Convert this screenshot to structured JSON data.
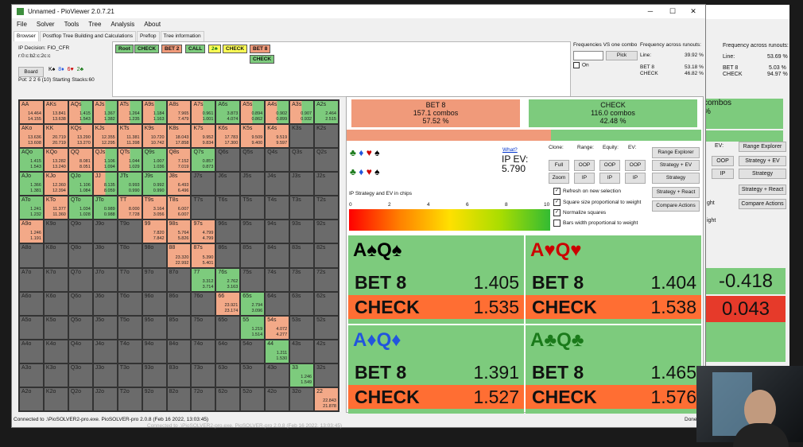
{
  "window": {
    "title": "Unnamed - PioViewer 2.0.7.21",
    "minimize": "─",
    "maximize": "☐",
    "close": "✕"
  },
  "menu": [
    "File",
    "Solver",
    "Tools",
    "Tree",
    "Analysis",
    "About"
  ],
  "tabs": [
    "Browser",
    "Postflop Tree Building and Calculations",
    "Preflop",
    "Tree information"
  ],
  "info": {
    "decision": "IP Decision:  FIO_CFR",
    "board_line": "r:0:c:b2:c:2c:c",
    "board_btn": "Board",
    "board_cards": [
      "K♠",
      "8♦",
      "6♥",
      "2♣"
    ],
    "pot": "Pot: 2 2 6 (10)  Starting Stacks:60"
  },
  "tree": {
    "nodes": [
      "Root",
      "CHECK",
      "BET 2",
      "CALL",
      "2♣",
      "CHECK",
      "BET 8"
    ],
    "sub": "CHECK"
  },
  "freq": {
    "vs_one": "Frequencies VS one combo",
    "pick": "Pick",
    "on": "On",
    "across": "Frequency across runouts:",
    "line_label": "Line:",
    "line_val": "39.92 %",
    "bet_label": "BET 8",
    "bet_val": "53.18 %",
    "check_label": "CHECK",
    "check_val": "46.82 %"
  },
  "bg": {
    "freq_title": "Frequency across runouts:",
    "line_label": "Line:",
    "line_val": "53.69 %",
    "bet_label": "BET 8",
    "bet_val": "5.03 %",
    "check_label": "CHECK",
    "check_val": "94.97 %",
    "ev": "EV:",
    "oop": "OOP",
    "ip": "IP",
    "range": "Range Explorer",
    "sev": "Strategy + EV",
    "str": "Strategy",
    "sr": "Strategy + React",
    "ca": "Compare Actions",
    "v1": "-0.418",
    "v2": "0.043",
    "combos": "combos",
    "pct": "%",
    "ght": "ght",
    "ight": "ight"
  },
  "actions": {
    "bet": {
      "name": "BET 8",
      "combos": "157.1 combos",
      "pct": "57.52 %"
    },
    "check": {
      "name": "CHECK",
      "combos": "116.0 combos",
      "pct": "42.48 %"
    }
  },
  "combos_rows": [
    [
      "♣",
      "♦",
      "♥",
      "♠"
    ],
    [
      "♣",
      "♦",
      "♥",
      "♠"
    ]
  ],
  "ev": {
    "what": "What?",
    "label": "IP EV:",
    "value": "5.790"
  },
  "controls": {
    "clone": "Clone:",
    "range": "Range:",
    "equity": "Equity:",
    "evl": "EV:",
    "full": "Full",
    "zoom": "Zoom",
    "oop": "OOP",
    "ip": "IP",
    "range_explorer": "Range Explorer",
    "strategy_ev": "Strategy + EV",
    "strategy": "Strategy",
    "strategy_react": "Strategy + React",
    "compare": "Compare Actions"
  },
  "scale": {
    "label": "IP Strategy and EV in chips",
    "ticks": [
      "0",
      "2",
      "4",
      "6",
      "8",
      "10"
    ]
  },
  "checks": [
    {
      "on": true,
      "label": "Refresh on new selection"
    },
    {
      "on": true,
      "label": "Square size proportional to weight"
    },
    {
      "on": true,
      "label": "Normalize squares"
    },
    {
      "on": false,
      "label": "Bars width proportional to weight"
    }
  ],
  "bigcells": [
    {
      "r1": "A",
      "s1": "♠",
      "r2": "Q",
      "s2": "♠",
      "color": "#000000",
      "bet": "1.405",
      "check": "1.535"
    },
    {
      "r1": "A",
      "s1": "♥",
      "r2": "Q",
      "s2": "♥",
      "color": "#cc0000",
      "bet": "1.404",
      "check": "1.538"
    },
    {
      "r1": "A",
      "s1": "♦",
      "r2": "Q",
      "s2": "♦",
      "color": "#2255dd",
      "bet": "1.391",
      "check": "1.527"
    },
    {
      "r1": "A",
      "s1": "♣",
      "r2": "Q",
      "s2": "♣",
      "color": "#1a7a1a",
      "bet": "1.465",
      "check": "1.576"
    }
  ],
  "bet_word": "BET 8",
  "check_word": "CHECK",
  "status": "Connected to .\\PioSOLVER2-pro.exe.  PioSOLVER-pro 2.0.8 (Feb 16 2022, 13:03:45)",
  "status_dim": "Connected to .\\PioSOLVER2-pro.exe.  PioSOLVER-pro 2.0.8 (Feb 16 2022, 13:03:45)",
  "done": "Done",
  "matrix_rows": [
    [
      {
        "l": "AA",
        "a": "14.464",
        "b": "14.155",
        "c": "h"
      },
      {
        "l": "AKs",
        "a": "13.841",
        "b": "13.638",
        "c": "h"
      },
      {
        "l": "AQs",
        "a": "1.415",
        "b": "1.543",
        "c": "m"
      },
      {
        "l": "AJs",
        "a": "1.367",
        "b": "1.382",
        "c": "m"
      },
      {
        "l": "ATs",
        "a": "1.264",
        "b": "1.235",
        "c": "m"
      },
      {
        "l": "A9s",
        "a": "1.184",
        "b": "1.163",
        "c": "m"
      },
      {
        "l": "A8s",
        "a": "7.965",
        "b": "7.479",
        "c": "h"
      },
      {
        "l": "A7s",
        "a": "0.961",
        "b": "1.001",
        "c": "m"
      },
      {
        "l": "A6s",
        "a": "3.873",
        "b": "4.074",
        "c": "c"
      },
      {
        "l": "A5s",
        "a": "0.894",
        "b": "0.862",
        "c": "m"
      },
      {
        "l": "A4s",
        "a": "0.902",
        "b": "0.899",
        "c": "m"
      },
      {
        "l": "A3s",
        "a": "0.907",
        "b": "0.932",
        "c": "m"
      },
      {
        "l": "A2s",
        "a": "2.464",
        "b": "2.515",
        "c": "c"
      }
    ],
    [
      {
        "l": "AKo",
        "a": "13.636",
        "b": "13.608",
        "c": "h"
      },
      {
        "l": "KK",
        "a": "20.719",
        "b": "20.719",
        "c": "h"
      },
      {
        "l": "KQs",
        "a": "13.290",
        "b": "13.270",
        "c": "h"
      },
      {
        "l": "KJs",
        "a": "12.355",
        "b": "12.295",
        "c": "h"
      },
      {
        "l": "KTs",
        "a": "11.381",
        "b": "11.398",
        "c": "h"
      },
      {
        "l": "K9s",
        "a": "10.720",
        "b": "10.742",
        "c": "h"
      },
      {
        "l": "K8s",
        "a": "18.043",
        "b": "17.858",
        "c": "h"
      },
      {
        "l": "K7s",
        "a": "9.952",
        "b": "9.834",
        "c": "h"
      },
      {
        "l": "K6s",
        "a": "17.783",
        "b": "17.300",
        "c": "h"
      },
      {
        "l": "K5s",
        "a": "9.509",
        "b": "9.400",
        "c": "h"
      },
      {
        "l": "K4s",
        "a": "9.519",
        "b": "9.597",
        "c": "h"
      },
      {
        "l": "K3s",
        "a": "",
        "b": "",
        "c": "g"
      },
      {
        "l": "K2s",
        "a": "",
        "b": "",
        "c": "g"
      }
    ],
    [
      {
        "l": "AQo",
        "a": "1.415",
        "b": "1.543",
        "c": "c"
      },
      {
        "l": "KQo",
        "a": "13.282",
        "b": "13.240",
        "c": "h"
      },
      {
        "l": "QQ",
        "a": "8.081",
        "b": "8.051",
        "c": "h"
      },
      {
        "l": "QJs",
        "a": "1.106",
        "b": "1.094",
        "c": "m"
      },
      {
        "l": "QTs",
        "a": "1.044",
        "b": "1.029",
        "c": "m"
      },
      {
        "l": "Q9s",
        "a": "1.007",
        "b": "1.036",
        "c": "c"
      },
      {
        "l": "Q8s",
        "a": "7.152",
        "b": "7.019",
        "c": "h"
      },
      {
        "l": "Q7s",
        "a": "0.857",
        "b": "0.873",
        "c": "c"
      },
      {
        "l": "Q6s",
        "a": "",
        "b": "",
        "c": "g"
      },
      {
        "l": "Q5s",
        "a": "",
        "b": "",
        "c": "g"
      },
      {
        "l": "Q4s",
        "a": "",
        "b": "",
        "c": "g"
      },
      {
        "l": "Q3s",
        "a": "",
        "b": "",
        "c": "g"
      },
      {
        "l": "Q2s",
        "a": "",
        "b": "",
        "c": "g"
      }
    ],
    [
      {
        "l": "AJo",
        "a": "1.366",
        "b": "1.381",
        "c": "c"
      },
      {
        "l": "KJo",
        "a": "12.360",
        "b": "12.394",
        "c": "h"
      },
      {
        "l": "QJo",
        "a": "1.106",
        "b": "1.084",
        "c": "c"
      },
      {
        "l": "JJ",
        "a": "8.135",
        "b": "8.059",
        "c": "m"
      },
      {
        "l": "JTs",
        "a": "0.993",
        "b": "0.990",
        "c": "c"
      },
      {
        "l": "J9s",
        "a": "0.992",
        "b": "0.990",
        "c": "c"
      },
      {
        "l": "J8s",
        "a": "6.493",
        "b": "6.496",
        "c": "h"
      },
      {
        "l": "J7s",
        "a": "",
        "b": "",
        "c": "g"
      },
      {
        "l": "J6s",
        "a": "",
        "b": "",
        "c": "g"
      },
      {
        "l": "J5s",
        "a": "",
        "b": "",
        "c": "g"
      },
      {
        "l": "J4s",
        "a": "",
        "b": "",
        "c": "g"
      },
      {
        "l": "J3s",
        "a": "",
        "b": "",
        "c": "g"
      },
      {
        "l": "J2s",
        "a": "",
        "b": "",
        "c": "g"
      }
    ],
    [
      {
        "l": "ATo",
        "a": "1.241",
        "b": "1.232",
        "c": "c"
      },
      {
        "l": "KTo",
        "a": "11.377",
        "b": "11.360",
        "c": "h"
      },
      {
        "l": "QTo",
        "a": "1.034",
        "b": "1.028",
        "c": "c"
      },
      {
        "l": "JTo",
        "a": "0.989",
        "b": "0.988",
        "c": "c"
      },
      {
        "l": "TT",
        "a": "8.000",
        "b": "7.728",
        "c": "h"
      },
      {
        "l": "T9s",
        "a": "3.164",
        "b": "3.056",
        "c": "h"
      },
      {
        "l": "T8s",
        "a": "6.007",
        "b": "6.007",
        "c": "h"
      },
      {
        "l": "T7s",
        "a": "",
        "b": "",
        "c": "g"
      },
      {
        "l": "T6s",
        "a": "",
        "b": "",
        "c": "g"
      },
      {
        "l": "T5s",
        "a": "",
        "b": "",
        "c": "g"
      },
      {
        "l": "T4s",
        "a": "",
        "b": "",
        "c": "g"
      },
      {
        "l": "T3s",
        "a": "",
        "b": "",
        "c": "g"
      },
      {
        "l": "T2s",
        "a": "",
        "b": "",
        "c": "g"
      }
    ],
    [
      {
        "l": "A9o",
        "a": "1.246",
        "b": "1.191",
        "c": "h"
      },
      {
        "l": "K9o",
        "a": "",
        "b": "",
        "c": "g"
      },
      {
        "l": "Q9o",
        "a": "",
        "b": "",
        "c": "g"
      },
      {
        "l": "J9o",
        "a": "",
        "b": "",
        "c": "g"
      },
      {
        "l": "T9o",
        "a": "",
        "b": "",
        "c": "g"
      },
      {
        "l": "99",
        "a": "7.820",
        "b": "7.842",
        "c": "h"
      },
      {
        "l": "98s",
        "a": "5.764",
        "b": "5.826",
        "c": "h"
      },
      {
        "l": "97s",
        "a": "4.799",
        "b": "4.799",
        "c": "h"
      },
      {
        "l": "96s",
        "a": "",
        "b": "",
        "c": "g"
      },
      {
        "l": "95s",
        "a": "",
        "b": "",
        "c": "g"
      },
      {
        "l": "94s",
        "a": "",
        "b": "",
        "c": "g"
      },
      {
        "l": "93s",
        "a": "",
        "b": "",
        "c": "g"
      },
      {
        "l": "92s",
        "a": "",
        "b": "",
        "c": "g"
      }
    ],
    [
      {
        "l": "A8o",
        "a": "",
        "b": "",
        "c": "g"
      },
      {
        "l": "K8o",
        "a": "",
        "b": "",
        "c": "g"
      },
      {
        "l": "Q8o",
        "a": "",
        "b": "",
        "c": "g"
      },
      {
        "l": "J8o",
        "a": "",
        "b": "",
        "c": "g"
      },
      {
        "l": "T8o",
        "a": "",
        "b": "",
        "c": "g"
      },
      {
        "l": "98o",
        "a": "",
        "b": "",
        "c": "g"
      },
      {
        "l": "88",
        "a": "23.320",
        "b": "22.992",
        "c": "h"
      },
      {
        "l": "87s",
        "a": "5.390",
        "b": "5.401",
        "c": "h"
      },
      {
        "l": "86s",
        "a": "",
        "b": "",
        "c": "g"
      },
      {
        "l": "85s",
        "a": "",
        "b": "",
        "c": "g"
      },
      {
        "l": "84s",
        "a": "",
        "b": "",
        "c": "g"
      },
      {
        "l": "83s",
        "a": "",
        "b": "",
        "c": "g"
      },
      {
        "l": "82s",
        "a": "",
        "b": "",
        "c": "g"
      }
    ],
    [
      {
        "l": "A7o",
        "a": "",
        "b": "",
        "c": "g"
      },
      {
        "l": "K7o",
        "a": "",
        "b": "",
        "c": "g"
      },
      {
        "l": "Q7o",
        "a": "",
        "b": "",
        "c": "g"
      },
      {
        "l": "J7o",
        "a": "",
        "b": "",
        "c": "g"
      },
      {
        "l": "T7o",
        "a": "",
        "b": "",
        "c": "g"
      },
      {
        "l": "97o",
        "a": "",
        "b": "",
        "c": "g"
      },
      {
        "l": "87o",
        "a": "",
        "b": "",
        "c": "g"
      },
      {
        "l": "77",
        "a": "3.312",
        "b": "3.714",
        "c": "c"
      },
      {
        "l": "76s",
        "a": "2.762",
        "b": "3.163",
        "c": "c"
      },
      {
        "l": "75s",
        "a": "",
        "b": "",
        "c": "g"
      },
      {
        "l": "74s",
        "a": "",
        "b": "",
        "c": "g"
      },
      {
        "l": "73s",
        "a": "",
        "b": "",
        "c": "g"
      },
      {
        "l": "72s",
        "a": "",
        "b": "",
        "c": "g"
      }
    ],
    [
      {
        "l": "A6o",
        "a": "",
        "b": "",
        "c": "g"
      },
      {
        "l": "K6o",
        "a": "",
        "b": "",
        "c": "g"
      },
      {
        "l": "Q6o",
        "a": "",
        "b": "",
        "c": "g"
      },
      {
        "l": "J6o",
        "a": "",
        "b": "",
        "c": "g"
      },
      {
        "l": "T6o",
        "a": "",
        "b": "",
        "c": "g"
      },
      {
        "l": "96o",
        "a": "",
        "b": "",
        "c": "g"
      },
      {
        "l": "86o",
        "a": "",
        "b": "",
        "c": "g"
      },
      {
        "l": "76o",
        "a": "",
        "b": "",
        "c": "g"
      },
      {
        "l": "66",
        "a": "23.921",
        "b": "23.174",
        "c": "h"
      },
      {
        "l": "65s",
        "a": "2.794",
        "b": "3.096",
        "c": "c"
      },
      {
        "l": "64s",
        "a": "",
        "b": "",
        "c": "g"
      },
      {
        "l": "63s",
        "a": "",
        "b": "",
        "c": "g"
      },
      {
        "l": "62s",
        "a": "",
        "b": "",
        "c": "g"
      }
    ],
    [
      {
        "l": "A5o",
        "a": "",
        "b": "",
        "c": "g"
      },
      {
        "l": "K5o",
        "a": "",
        "b": "",
        "c": "g"
      },
      {
        "l": "Q5o",
        "a": "",
        "b": "",
        "c": "g"
      },
      {
        "l": "J5o",
        "a": "",
        "b": "",
        "c": "g"
      },
      {
        "l": "T5o",
        "a": "",
        "b": "",
        "c": "g"
      },
      {
        "l": "95o",
        "a": "",
        "b": "",
        "c": "g"
      },
      {
        "l": "85o",
        "a": "",
        "b": "",
        "c": "g"
      },
      {
        "l": "75o",
        "a": "",
        "b": "",
        "c": "g"
      },
      {
        "l": "65o",
        "a": "",
        "b": "",
        "c": "g"
      },
      {
        "l": "55",
        "a": "1.219",
        "b": "1.514",
        "c": "c"
      },
      {
        "l": "54s",
        "a": "4.072",
        "b": "4.277",
        "c": "h"
      },
      {
        "l": "53s",
        "a": "",
        "b": "",
        "c": "g"
      },
      {
        "l": "52s",
        "a": "",
        "b": "",
        "c": "g"
      }
    ],
    [
      {
        "l": "A4o",
        "a": "",
        "b": "",
        "c": "g"
      },
      {
        "l": "K4o",
        "a": "",
        "b": "",
        "c": "g"
      },
      {
        "l": "Q4o",
        "a": "",
        "b": "",
        "c": "g"
      },
      {
        "l": "J4o",
        "a": "",
        "b": "",
        "c": "g"
      },
      {
        "l": "T4o",
        "a": "",
        "b": "",
        "c": "g"
      },
      {
        "l": "94o",
        "a": "",
        "b": "",
        "c": "g"
      },
      {
        "l": "84o",
        "a": "",
        "b": "",
        "c": "g"
      },
      {
        "l": "74o",
        "a": "",
        "b": "",
        "c": "g"
      },
      {
        "l": "64o",
        "a": "",
        "b": "",
        "c": "g"
      },
      {
        "l": "54o",
        "a": "",
        "b": "",
        "c": "g"
      },
      {
        "l": "44",
        "a": "1.211",
        "b": "1.530",
        "c": "c"
      },
      {
        "l": "43s",
        "a": "",
        "b": "",
        "c": "g"
      },
      {
        "l": "42s",
        "a": "",
        "b": "",
        "c": "g"
      }
    ],
    [
      {
        "l": "A3o",
        "a": "",
        "b": "",
        "c": "g"
      },
      {
        "l": "K3o",
        "a": "",
        "b": "",
        "c": "g"
      },
      {
        "l": "Q3o",
        "a": "",
        "b": "",
        "c": "g"
      },
      {
        "l": "J3o",
        "a": "",
        "b": "",
        "c": "g"
      },
      {
        "l": "T3o",
        "a": "",
        "b": "",
        "c": "g"
      },
      {
        "l": "93o",
        "a": "",
        "b": "",
        "c": "g"
      },
      {
        "l": "83o",
        "a": "",
        "b": "",
        "c": "g"
      },
      {
        "l": "73o",
        "a": "",
        "b": "",
        "c": "g"
      },
      {
        "l": "63o",
        "a": "",
        "b": "",
        "c": "g"
      },
      {
        "l": "53o",
        "a": "",
        "b": "",
        "c": "g"
      },
      {
        "l": "43o",
        "a": "",
        "b": "",
        "c": "g"
      },
      {
        "l": "33",
        "a": "1.246",
        "b": "1.549",
        "c": "c"
      },
      {
        "l": "32s",
        "a": "",
        "b": "",
        "c": "g"
      }
    ],
    [
      {
        "l": "A2o",
        "a": "",
        "b": "",
        "c": "g"
      },
      {
        "l": "K2o",
        "a": "",
        "b": "",
        "c": "g"
      },
      {
        "l": "Q2o",
        "a": "",
        "b": "",
        "c": "g"
      },
      {
        "l": "J2o",
        "a": "",
        "b": "",
        "c": "g"
      },
      {
        "l": "T2o",
        "a": "",
        "b": "",
        "c": "g"
      },
      {
        "l": "92o",
        "a": "",
        "b": "",
        "c": "g"
      },
      {
        "l": "82o",
        "a": "",
        "b": "",
        "c": "g"
      },
      {
        "l": "72o",
        "a": "",
        "b": "",
        "c": "g"
      },
      {
        "l": "62o",
        "a": "",
        "b": "",
        "c": "g"
      },
      {
        "l": "52o",
        "a": "",
        "b": "",
        "c": "g"
      },
      {
        "l": "42o",
        "a": "",
        "b": "",
        "c": "g"
      },
      {
        "l": "32o",
        "a": "",
        "b": "",
        "c": "g"
      },
      {
        "l": "22",
        "a": "22.843",
        "b": "21.878",
        "c": "h"
      }
    ]
  ],
  "colors": {
    "bet": "#f09a7a",
    "check": "#7dcb7d",
    "mixed_bet": "#f3a988",
    "gray": "#6b6b6b",
    "check_orange": "#ff6e33"
  }
}
